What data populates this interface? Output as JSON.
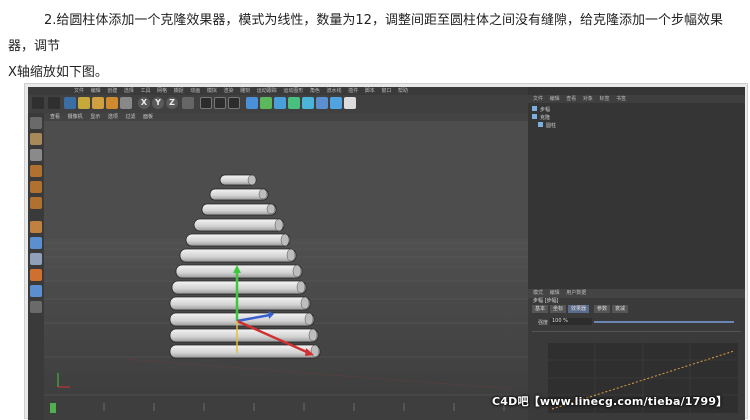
{
  "article": {
    "line1": "2.给圆柱体添加一个克隆效果器，模式为线性，数量为12，调整间距至圆柱体之间没有缝隙，给克隆添加一个步幅效果器，调节",
    "line2": "X轴缩放如下图。"
  },
  "app": {
    "menu_items": [
      "文件",
      "编辑",
      "创建",
      "选择",
      "工具",
      "网格",
      "捕捉",
      "动画",
      "模拟",
      "渲染",
      "雕刻",
      "运动跟踪",
      "运动图形",
      "角色",
      "流水线",
      "插件",
      "脚本",
      "窗口",
      "帮助"
    ],
    "toolbar_axes": [
      "X",
      "Y",
      "Z"
    ],
    "viewport_menu": [
      "查看",
      "摄像机",
      "显示",
      "选项",
      "过滤",
      "面板"
    ],
    "object_tabs": [
      "文件",
      "编辑",
      "查看",
      "对象",
      "标签",
      "书签"
    ],
    "objects": [
      {
        "name": "步幅"
      },
      {
        "name": "克隆"
      },
      {
        "name": "圆柱"
      }
    ],
    "attribute_tabs": [
      "模式",
      "编辑",
      "用户数据"
    ],
    "attribute_title": "步幅 [步幅]",
    "attribute_subtabs": [
      "基本",
      "坐标",
      "效果器",
      "参数",
      "衰减"
    ],
    "attribute_fields": [
      {
        "label": "强度",
        "value": "100 %"
      }
    ]
  },
  "watermark": "C4D吧【www.linecg.com/tieba/1799】",
  "colors": {
    "ui_dark": "#3b3b3b",
    "viewport": "#4b4b4b",
    "accent_blue": "#5b6b8d"
  }
}
